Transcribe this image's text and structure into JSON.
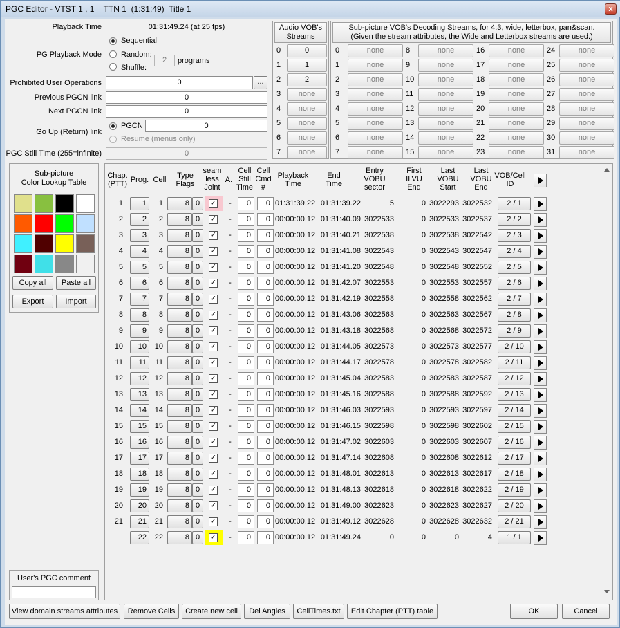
{
  "window": {
    "title": "PGC Editor - VTST 1 , 1    TTN 1  (1:31:49)  Title 1",
    "close": "x"
  },
  "props": {
    "playback_time_label": "Playback Time",
    "playback_time": "01:31:49.24 (at 25 fps)",
    "pg_mode_label": "PG Playback Mode",
    "sequential": "Sequential",
    "random": "Random:",
    "shuffle": "Shuffle:",
    "programs_value": "2",
    "programs_label": "programs",
    "prohibited_label": "Prohibited User Operations",
    "prohibited_value": "0",
    "ellipsis": "...",
    "prev_label": "Previous PGCN link",
    "prev_value": "0",
    "next_label": "Next PGCN link",
    "next_value": "0",
    "goup_label": "Go Up (Return) link",
    "pgcn_label": "PGCN",
    "goup_value": "0",
    "resume_label": "Resume (menus only)",
    "still_label": "PGC Still Time (255=infinite)",
    "still_value": "0"
  },
  "audio": {
    "title": "Audio VOB's Streams",
    "streams": [
      {
        "n": "0",
        "v": "0"
      },
      {
        "n": "1",
        "v": "1"
      },
      {
        "n": "2",
        "v": "2"
      },
      {
        "n": "3",
        "v": "none"
      },
      {
        "n": "4",
        "v": "none"
      },
      {
        "n": "5",
        "v": "none"
      },
      {
        "n": "6",
        "v": "none"
      },
      {
        "n": "7",
        "v": "none"
      }
    ]
  },
  "subpic": {
    "title1": "Sub-picture VOB's Decoding Streams, for 4:3, wide, letterbox, pan&scan.",
    "title2": "(Given the stream attributes, the Wide and Letterbox streams are used.)",
    "none": "none"
  },
  "clut": {
    "title1": "Sub-picture",
    "title2": "Color Lookup Table",
    "colors": [
      "#e0e08c",
      "#88c040",
      "#000000",
      "#ffffff",
      "#ff5a00",
      "#ff0000",
      "#00ff00",
      "#c0e0ff",
      "#40f0ff",
      "#500000",
      "#ffff00",
      "#786058",
      "#700010",
      "#40e0e8",
      "#888888",
      "#f0f0f0"
    ],
    "copy": "Copy all",
    "paste": "Paste all",
    "export": "Export",
    "import": "Import"
  },
  "comment": {
    "label": "User's PGC comment",
    "value": ""
  },
  "table": {
    "headers": {
      "chap": "Chap.\n(PTT)",
      "prog": "Prog.",
      "cell": "Cell",
      "type": "Type\nFlags",
      "seam": "seam\nless\nJoint",
      "a": "A.",
      "still": "Cell\nStill\nTime",
      "cmd": "Cell\nCmd\n#",
      "pbt": "Playback\nTime",
      "end": "End\nTime",
      "entry": "Entry\nVOBU\nsector",
      "ilvu": "First\nILVU\nEnd",
      "lstart": "Last\nVOBU\nStart",
      "lend": "Last\nVOBU\nEnd",
      "vobcell": "VOB/Cell\nID"
    },
    "rows": [
      {
        "chap": "1",
        "prog": "1",
        "cell": "1",
        "type": "8",
        "flag": "0",
        "seam": "✓",
        "a": "-",
        "still": "0",
        "cmd": "0",
        "pbt": "01:31:39.22",
        "end": "01:31:39.22",
        "entry": "5",
        "ilvu": "0",
        "ls": "3022293",
        "le": "3022532",
        "vc": "2 / 1"
      },
      {
        "chap": "2",
        "prog": "2",
        "cell": "2",
        "type": "8",
        "flag": "0",
        "seam": "✓",
        "a": "-",
        "still": "0",
        "cmd": "0",
        "pbt": "00:00:00.12",
        "end": "01:31:40.09",
        "entry": "3022533",
        "ilvu": "0",
        "ls": "3022533",
        "le": "3022537",
        "vc": "2 / 2"
      },
      {
        "chap": "3",
        "prog": "3",
        "cell": "3",
        "type": "8",
        "flag": "0",
        "seam": "✓",
        "a": "-",
        "still": "0",
        "cmd": "0",
        "pbt": "00:00:00.12",
        "end": "01:31:40.21",
        "entry": "3022538",
        "ilvu": "0",
        "ls": "3022538",
        "le": "3022542",
        "vc": "2 / 3"
      },
      {
        "chap": "4",
        "prog": "4",
        "cell": "4",
        "type": "8",
        "flag": "0",
        "seam": "✓",
        "a": "-",
        "still": "0",
        "cmd": "0",
        "pbt": "00:00:00.12",
        "end": "01:31:41.08",
        "entry": "3022543",
        "ilvu": "0",
        "ls": "3022543",
        "le": "3022547",
        "vc": "2 / 4"
      },
      {
        "chap": "5",
        "prog": "5",
        "cell": "5",
        "type": "8",
        "flag": "0",
        "seam": "✓",
        "a": "-",
        "still": "0",
        "cmd": "0",
        "pbt": "00:00:00.12",
        "end": "01:31:41.20",
        "entry": "3022548",
        "ilvu": "0",
        "ls": "3022548",
        "le": "3022552",
        "vc": "2 / 5"
      },
      {
        "chap": "6",
        "prog": "6",
        "cell": "6",
        "type": "8",
        "flag": "0",
        "seam": "✓",
        "a": "-",
        "still": "0",
        "cmd": "0",
        "pbt": "00:00:00.12",
        "end": "01:31:42.07",
        "entry": "3022553",
        "ilvu": "0",
        "ls": "3022553",
        "le": "3022557",
        "vc": "2 / 6"
      },
      {
        "chap": "7",
        "prog": "7",
        "cell": "7",
        "type": "8",
        "flag": "0",
        "seam": "✓",
        "a": "-",
        "still": "0",
        "cmd": "0",
        "pbt": "00:00:00.12",
        "end": "01:31:42.19",
        "entry": "3022558",
        "ilvu": "0",
        "ls": "3022558",
        "le": "3022562",
        "vc": "2 / 7"
      },
      {
        "chap": "8",
        "prog": "8",
        "cell": "8",
        "type": "8",
        "flag": "0",
        "seam": "✓",
        "a": "-",
        "still": "0",
        "cmd": "0",
        "pbt": "00:00:00.12",
        "end": "01:31:43.06",
        "entry": "3022563",
        "ilvu": "0",
        "ls": "3022563",
        "le": "3022567",
        "vc": "2 / 8"
      },
      {
        "chap": "9",
        "prog": "9",
        "cell": "9",
        "type": "8",
        "flag": "0",
        "seam": "✓",
        "a": "-",
        "still": "0",
        "cmd": "0",
        "pbt": "00:00:00.12",
        "end": "01:31:43.18",
        "entry": "3022568",
        "ilvu": "0",
        "ls": "3022568",
        "le": "3022572",
        "vc": "2 / 9"
      },
      {
        "chap": "10",
        "prog": "10",
        "cell": "10",
        "type": "8",
        "flag": "0",
        "seam": "✓",
        "a": "-",
        "still": "0",
        "cmd": "0",
        "pbt": "00:00:00.12",
        "end": "01:31:44.05",
        "entry": "3022573",
        "ilvu": "0",
        "ls": "3022573",
        "le": "3022577",
        "vc": "2 / 10"
      },
      {
        "chap": "11",
        "prog": "11",
        "cell": "11",
        "type": "8",
        "flag": "0",
        "seam": "✓",
        "a": "-",
        "still": "0",
        "cmd": "0",
        "pbt": "00:00:00.12",
        "end": "01:31:44.17",
        "entry": "3022578",
        "ilvu": "0",
        "ls": "3022578",
        "le": "3022582",
        "vc": "2 / 11"
      },
      {
        "chap": "12",
        "prog": "12",
        "cell": "12",
        "type": "8",
        "flag": "0",
        "seam": "✓",
        "a": "-",
        "still": "0",
        "cmd": "0",
        "pbt": "00:00:00.12",
        "end": "01:31:45.04",
        "entry": "3022583",
        "ilvu": "0",
        "ls": "3022583",
        "le": "3022587",
        "vc": "2 / 12"
      },
      {
        "chap": "13",
        "prog": "13",
        "cell": "13",
        "type": "8",
        "flag": "0",
        "seam": "✓",
        "a": "-",
        "still": "0",
        "cmd": "0",
        "pbt": "00:00:00.12",
        "end": "01:31:45.16",
        "entry": "3022588",
        "ilvu": "0",
        "ls": "3022588",
        "le": "3022592",
        "vc": "2 / 13"
      },
      {
        "chap": "14",
        "prog": "14",
        "cell": "14",
        "type": "8",
        "flag": "0",
        "seam": "✓",
        "a": "-",
        "still": "0",
        "cmd": "0",
        "pbt": "00:00:00.12",
        "end": "01:31:46.03",
        "entry": "3022593",
        "ilvu": "0",
        "ls": "3022593",
        "le": "3022597",
        "vc": "2 / 14"
      },
      {
        "chap": "15",
        "prog": "15",
        "cell": "15",
        "type": "8",
        "flag": "0",
        "seam": "✓",
        "a": "-",
        "still": "0",
        "cmd": "0",
        "pbt": "00:00:00.12",
        "end": "01:31:46.15",
        "entry": "3022598",
        "ilvu": "0",
        "ls": "3022598",
        "le": "3022602",
        "vc": "2 / 15"
      },
      {
        "chap": "16",
        "prog": "16",
        "cell": "16",
        "type": "8",
        "flag": "0",
        "seam": "✓",
        "a": "-",
        "still": "0",
        "cmd": "0",
        "pbt": "00:00:00.12",
        "end": "01:31:47.02",
        "entry": "3022603",
        "ilvu": "0",
        "ls": "3022603",
        "le": "3022607",
        "vc": "2 / 16"
      },
      {
        "chap": "17",
        "prog": "17",
        "cell": "17",
        "type": "8",
        "flag": "0",
        "seam": "✓",
        "a": "-",
        "still": "0",
        "cmd": "0",
        "pbt": "00:00:00.12",
        "end": "01:31:47.14",
        "entry": "3022608",
        "ilvu": "0",
        "ls": "3022608",
        "le": "3022612",
        "vc": "2 / 17"
      },
      {
        "chap": "18",
        "prog": "18",
        "cell": "18",
        "type": "8",
        "flag": "0",
        "seam": "✓",
        "a": "-",
        "still": "0",
        "cmd": "0",
        "pbt": "00:00:00.12",
        "end": "01:31:48.01",
        "entry": "3022613",
        "ilvu": "0",
        "ls": "3022613",
        "le": "3022617",
        "vc": "2 / 18"
      },
      {
        "chap": "19",
        "prog": "19",
        "cell": "19",
        "type": "8",
        "flag": "0",
        "seam": "✓",
        "a": "-",
        "still": "0",
        "cmd": "0",
        "pbt": "00:00:00.12",
        "end": "01:31:48.13",
        "entry": "3022618",
        "ilvu": "0",
        "ls": "3022618",
        "le": "3022622",
        "vc": "2 / 19"
      },
      {
        "chap": "20",
        "prog": "20",
        "cell": "20",
        "type": "8",
        "flag": "0",
        "seam": "✓",
        "a": "-",
        "still": "0",
        "cmd": "0",
        "pbt": "00:00:00.12",
        "end": "01:31:49.00",
        "entry": "3022623",
        "ilvu": "0",
        "ls": "3022623",
        "le": "3022627",
        "vc": "2 / 20"
      },
      {
        "chap": "21",
        "prog": "21",
        "cell": "21",
        "type": "8",
        "flag": "0",
        "seam": "✓",
        "a": "-",
        "still": "0",
        "cmd": "0",
        "pbt": "00:00:00.12",
        "end": "01:31:49.12",
        "entry": "3022628",
        "ilvu": "0",
        "ls": "3022628",
        "le": "3022632",
        "vc": "2 / 21"
      },
      {
        "chap": "",
        "prog": "22",
        "cell": "22",
        "type": "8",
        "flag": "0",
        "seam": "✓",
        "a": "-",
        "still": "0",
        "cmd": "0",
        "pbt": "00:00:00.12",
        "end": "01:31:49.24",
        "entry": "0",
        "ilvu": "0",
        "ls": "0",
        "le": "4",
        "vc": "1 / 1"
      }
    ]
  },
  "buttons": {
    "view": "View domain streams attributes",
    "remove": "Remove Cells",
    "create": "Create new cell",
    "del": "Del Angles",
    "celltimes": "CellTimes.txt",
    "editptt": "Edit Chapter (PTT) table",
    "ok": "OK",
    "cancel": "Cancel"
  }
}
